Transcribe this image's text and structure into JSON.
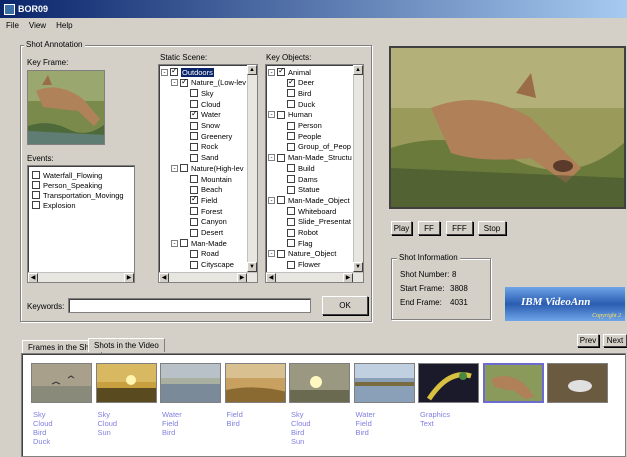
{
  "window": {
    "title": "BOR09"
  },
  "menu": [
    "File",
    "View",
    "Help"
  ],
  "shot_annotation": {
    "group_label": "Shot Annotation",
    "key_frame_label": "Key Frame:",
    "events_label": "Events:",
    "events": [
      {
        "label": "Waterfall_Flowing",
        "checked": false
      },
      {
        "label": "Person_Speaking",
        "checked": false
      },
      {
        "label": "Transportation_Movingg",
        "checked": false
      },
      {
        "label": "Explosion",
        "checked": false
      }
    ],
    "static_scene_label": "Static Scene:",
    "static_scene": [
      {
        "label": "Outdoors",
        "checked": true,
        "level": 0,
        "exp": "-",
        "selected": true
      },
      {
        "label": "Nature_(Low-lev",
        "checked": true,
        "level": 1,
        "exp": "-"
      },
      {
        "label": "Sky",
        "checked": false,
        "level": 2
      },
      {
        "label": "Cloud",
        "checked": false,
        "level": 2
      },
      {
        "label": "Water",
        "checked": true,
        "level": 2
      },
      {
        "label": "Snow",
        "checked": false,
        "level": 2
      },
      {
        "label": "Greenery",
        "checked": false,
        "level": 2
      },
      {
        "label": "Rock",
        "checked": false,
        "level": 2
      },
      {
        "label": "Sand",
        "checked": false,
        "level": 2
      },
      {
        "label": "Nature(High-lev",
        "checked": false,
        "level": 1,
        "exp": "-"
      },
      {
        "label": "Mountain",
        "checked": false,
        "level": 2
      },
      {
        "label": "Beach",
        "checked": false,
        "level": 2
      },
      {
        "label": "Field",
        "checked": true,
        "level": 2
      },
      {
        "label": "Forest",
        "checked": false,
        "level": 2
      },
      {
        "label": "Canyon",
        "checked": false,
        "level": 2
      },
      {
        "label": "Desert",
        "checked": false,
        "level": 2
      },
      {
        "label": "Man-Made",
        "checked": false,
        "level": 1,
        "exp": "-"
      },
      {
        "label": "Road",
        "checked": false,
        "level": 2
      },
      {
        "label": "Cityscape",
        "checked": false,
        "level": 2
      }
    ],
    "key_objects_label": "Key Objects:",
    "key_objects": [
      {
        "label": "Animal",
        "checked": true,
        "level": 0,
        "exp": "-"
      },
      {
        "label": "Deer",
        "checked": true,
        "level": 1
      },
      {
        "label": "Bird",
        "checked": false,
        "level": 1
      },
      {
        "label": "Duck",
        "checked": false,
        "level": 1
      },
      {
        "label": "Human",
        "checked": false,
        "level": 0,
        "exp": "-"
      },
      {
        "label": "Person",
        "checked": false,
        "level": 1
      },
      {
        "label": "People",
        "checked": false,
        "level": 1
      },
      {
        "label": "Group_of_Peop",
        "checked": false,
        "level": 1
      },
      {
        "label": "Man-Made_Structu",
        "checked": false,
        "level": 0,
        "exp": "-"
      },
      {
        "label": "Build",
        "checked": false,
        "level": 1
      },
      {
        "label": "Dams",
        "checked": false,
        "level": 1
      },
      {
        "label": "Statue",
        "checked": false,
        "level": 1
      },
      {
        "label": "Man-Made_Object",
        "checked": false,
        "level": 0,
        "exp": "-"
      },
      {
        "label": "Whiteboard",
        "checked": false,
        "level": 1
      },
      {
        "label": "Slide_Presentat",
        "checked": false,
        "level": 1
      },
      {
        "label": "Robot",
        "checked": false,
        "level": 1
      },
      {
        "label": "Flag",
        "checked": false,
        "level": 1
      },
      {
        "label": "Nature_Object",
        "checked": false,
        "level": 0,
        "exp": "-"
      },
      {
        "label": "Flower",
        "checked": false,
        "level": 1
      }
    ],
    "keywords_label": "Keywords:",
    "keywords_value": "",
    "ok_label": "OK"
  },
  "player": {
    "play": "Play",
    "ff": "FF",
    "fff": "FFF",
    "stop": "Stop"
  },
  "shot_info": {
    "group_label": "Shot Information",
    "number_label": "Shot Number:",
    "number": "8",
    "start_label": "Start Frame:",
    "start": "3808",
    "end_label": "End Frame:",
    "end": "4031"
  },
  "logo": {
    "text": "IBM VideoAnn",
    "sub": "Copyright 2"
  },
  "tabs": [
    "Frames in the Shot",
    "Shots in the Video"
  ],
  "nav": {
    "prev": "Prev",
    "next": "Next"
  },
  "shots": [
    {
      "tags": [
        "Sky",
        "Cloud",
        "Bird",
        "Duck"
      ],
      "scene": "sky-birds"
    },
    {
      "tags": [
        "Sky",
        "Cloud",
        "Sun"
      ],
      "scene": "sunset"
    },
    {
      "tags": [
        "Water",
        "Field",
        "Bird"
      ],
      "scene": "water-birds"
    },
    {
      "tags": [
        "Field",
        "Bird"
      ],
      "scene": "field"
    },
    {
      "tags": [
        "Sky",
        "Cloud",
        "Bird",
        "Sun"
      ],
      "scene": "sunset2"
    },
    {
      "tags": [
        "Water",
        "Field",
        "Bird"
      ],
      "scene": "water2"
    },
    {
      "tags": [
        "Graphics",
        "Text"
      ],
      "scene": "graphic"
    },
    {
      "tags": [],
      "scene": "deer",
      "selected": true
    },
    {
      "tags": [],
      "scene": "splash"
    }
  ],
  "colors": {
    "title_start": "#0a246a",
    "tag_text": "#8080e0"
  }
}
